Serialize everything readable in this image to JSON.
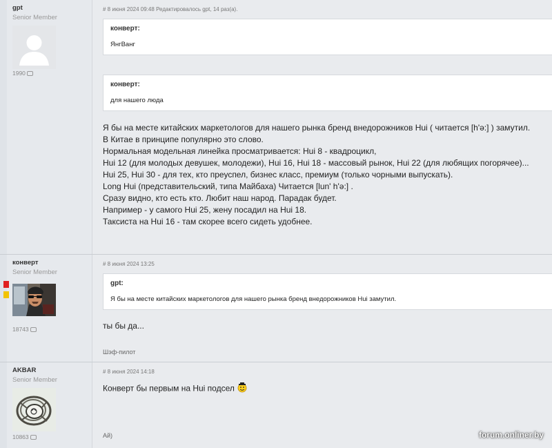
{
  "posts": [
    {
      "username": "gpt",
      "title": "Senior Member",
      "count": "1990",
      "date": "# 8 июня 2024 09:48",
      "edited": "Редактировалось gpt, 14 раз(а).",
      "quotes": [
        {
          "author": "конверт:",
          "text": "ЯнгВанг"
        },
        {
          "author": "конверт:",
          "text": "для нашего люда"
        }
      ],
      "lines": [
        "Я бы на месте китайских маркетологов для нашего рынка бренд внедорожников Hui ( читается [h'ә:] ) замутил.",
        "В Китае в принципе популярно это слово.",
        "Нормальная модельная линейка просматривается: Hui 8 - квадроцикл,",
        "Hui 12 (для молодых девушек, молодежи), Hui 16, Hui 18 - массовый рынок, Hui 22 (для любящих погорячее)...",
        "Hui 25, Hui 30 - для тех, кто преуспел, бизнес класс, премиум (только чорными выпускать).",
        "Long Hui (представительский, типа Майбаха) Читается [lun' h'ә:] .",
        "Сразу видно, кто есть кто. Любит наш народ. Парадак будет.",
        "Например - у самого Hui 25, жену посадил на Hui 18.",
        "Таксиста на Hui 16 - там скорее всего сидеть удобнее."
      ]
    },
    {
      "username": "конверт",
      "title": "Senior Member",
      "count": "18743",
      "date": "# 8 июня 2024 13:25",
      "quote": {
        "author": "gpt:",
        "text": "Я бы на месте китайских маркетологов для нашего рынка бренд внедорожников Hui замутил."
      },
      "message": "ты бы да...",
      "signature": "Шэф-пилот"
    },
    {
      "username": "AKBAR",
      "title": "Senior Member",
      "count": "10863",
      "date": "# 8 июня 2024 14:18",
      "message": "Конверт бы первым на Hui подсел",
      "signature": "Ай)"
    }
  ],
  "watermark": "forum.onliner.by",
  "colors": {
    "rep_red": "#e02020",
    "rep_yellow": "#f2c300"
  },
  "icons": [
    "message-bubble-icon",
    "smiley-icon",
    "default-avatar-icon"
  ]
}
